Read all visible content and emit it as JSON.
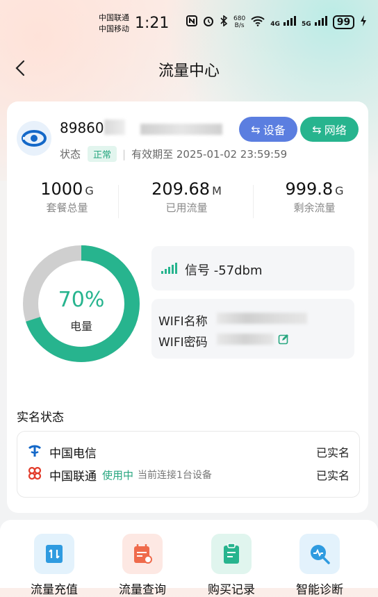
{
  "status_bar": {
    "carrier_1": "中国联通",
    "carrier_2": "中国移动",
    "time": "1:21",
    "speed_value": "680",
    "speed_unit": "B/s",
    "net_1": "4G",
    "net_2": "5G",
    "battery": "99"
  },
  "nav": {
    "title": "流量中心"
  },
  "device": {
    "iccid": "89860",
    "status_label": "状态",
    "status_badge": "正常",
    "expiry": "有效期至 2025-01-02 23:59:59",
    "device_button": "设备",
    "network_button": "网络"
  },
  "stats": [
    {
      "value": "1000",
      "unit": "G",
      "label": "套餐总量"
    },
    {
      "value": "209.68",
      "unit": "M",
      "label": "已用流量"
    },
    {
      "value": "999.8",
      "unit": "G",
      "label": "剩余流量"
    }
  ],
  "battery_ring": {
    "percent": 70,
    "percent_text": "70%",
    "label": "电量",
    "color": "#27b48e",
    "track_color": "#cfcfcf"
  },
  "signal": {
    "text": "信号 -57dbm"
  },
  "wifi": {
    "name_label": "WIFI名称",
    "password_label": "WIFI密码"
  },
  "real_name": {
    "title": "实名状态",
    "rows": [
      {
        "operator": "中国电信",
        "in_use": "",
        "connection": "",
        "status": "已实名"
      },
      {
        "operator": "中国联通",
        "in_use": "使用中",
        "connection": "当前连接1台设备",
        "status": "已实名"
      }
    ]
  },
  "shortcuts": [
    {
      "label": "流量充值",
      "icon": "recharge-icon",
      "color": "#2f9be0",
      "bg": "#e3f2fc"
    },
    {
      "label": "流量查询",
      "icon": "calendar-search-icon",
      "color": "#ef6a4b",
      "bg": "#fde8e3"
    },
    {
      "label": "购买记录",
      "icon": "clipboard-icon",
      "color": "#27b48e",
      "bg": "#e0f5ee"
    },
    {
      "label": "智能诊断",
      "icon": "diagnosis-icon",
      "color": "#2f9be0",
      "bg": "#e3f2fc"
    }
  ],
  "colors": {
    "accent": "#27b48e",
    "device_button": "#5b7ee0"
  }
}
